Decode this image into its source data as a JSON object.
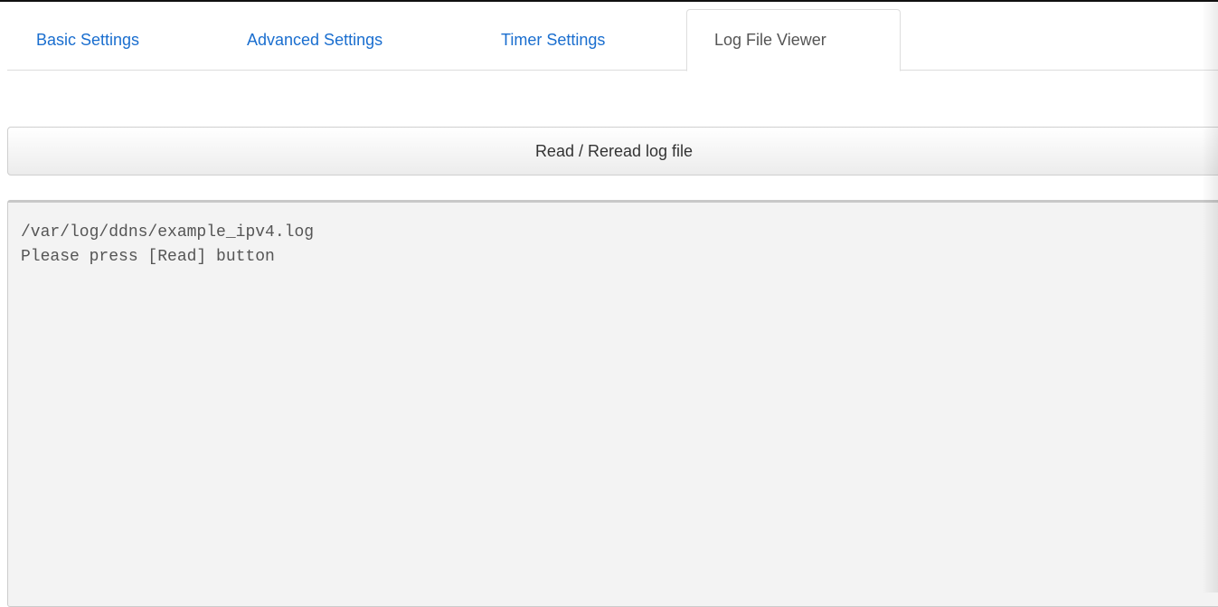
{
  "tabs": [
    {
      "label": "Basic Settings",
      "active": false
    },
    {
      "label": "Advanced Settings",
      "active": false
    },
    {
      "label": "Timer Settings",
      "active": false
    },
    {
      "label": "Log File Viewer",
      "active": true
    }
  ],
  "read_button": {
    "label": "Read / Reread log file"
  },
  "log_viewer": {
    "lines": [
      "/var/log/ddns/example_ipv4.log",
      "Please press [Read] button"
    ]
  },
  "colors": {
    "link": "#1a6ecf",
    "active_tab_text": "#555555",
    "log_background": "#f3f3f3"
  }
}
